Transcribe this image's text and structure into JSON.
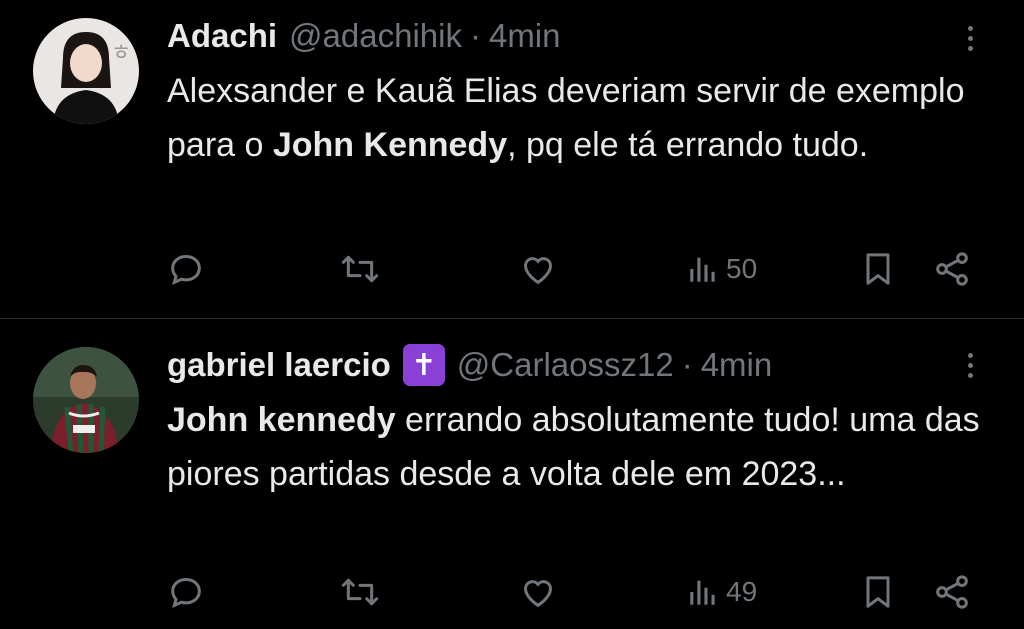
{
  "theme": {
    "background": "#000000",
    "text": "#e7e9ea",
    "muted": "#71767b",
    "divider": "#2f3336",
    "emoji_bg": "#8a3fd6"
  },
  "tweets": [
    {
      "name": "Adachi",
      "handle": "@adachihik",
      "separator": "·",
      "time": "4min",
      "text_parts": [
        "Alexsander e Kauã Elias deveriam servir de exemplo para o ",
        "John Kennedy",
        ", pq ele tá errando tudo."
      ],
      "actions": {
        "reply_icon": "reply-icon",
        "retweet_icon": "retweet-icon",
        "like_icon": "like-icon",
        "views": "50",
        "bookmark_icon": "bookmark-icon",
        "share_icon": "share-icon"
      }
    },
    {
      "name": "gabriel laercio",
      "emoji": "✝",
      "handle": "@Carlaossz12",
      "separator": "·",
      "time": "4min",
      "text_parts": [
        "John kennedy",
        " errando absolutamente tudo! uma das piores partidas desde a volta dele em 2023..."
      ],
      "actions": {
        "reply_icon": "reply-icon",
        "retweet_icon": "retweet-icon",
        "like_icon": "like-icon",
        "views": "49",
        "bookmark_icon": "bookmark-icon",
        "share_icon": "share-icon"
      }
    }
  ]
}
